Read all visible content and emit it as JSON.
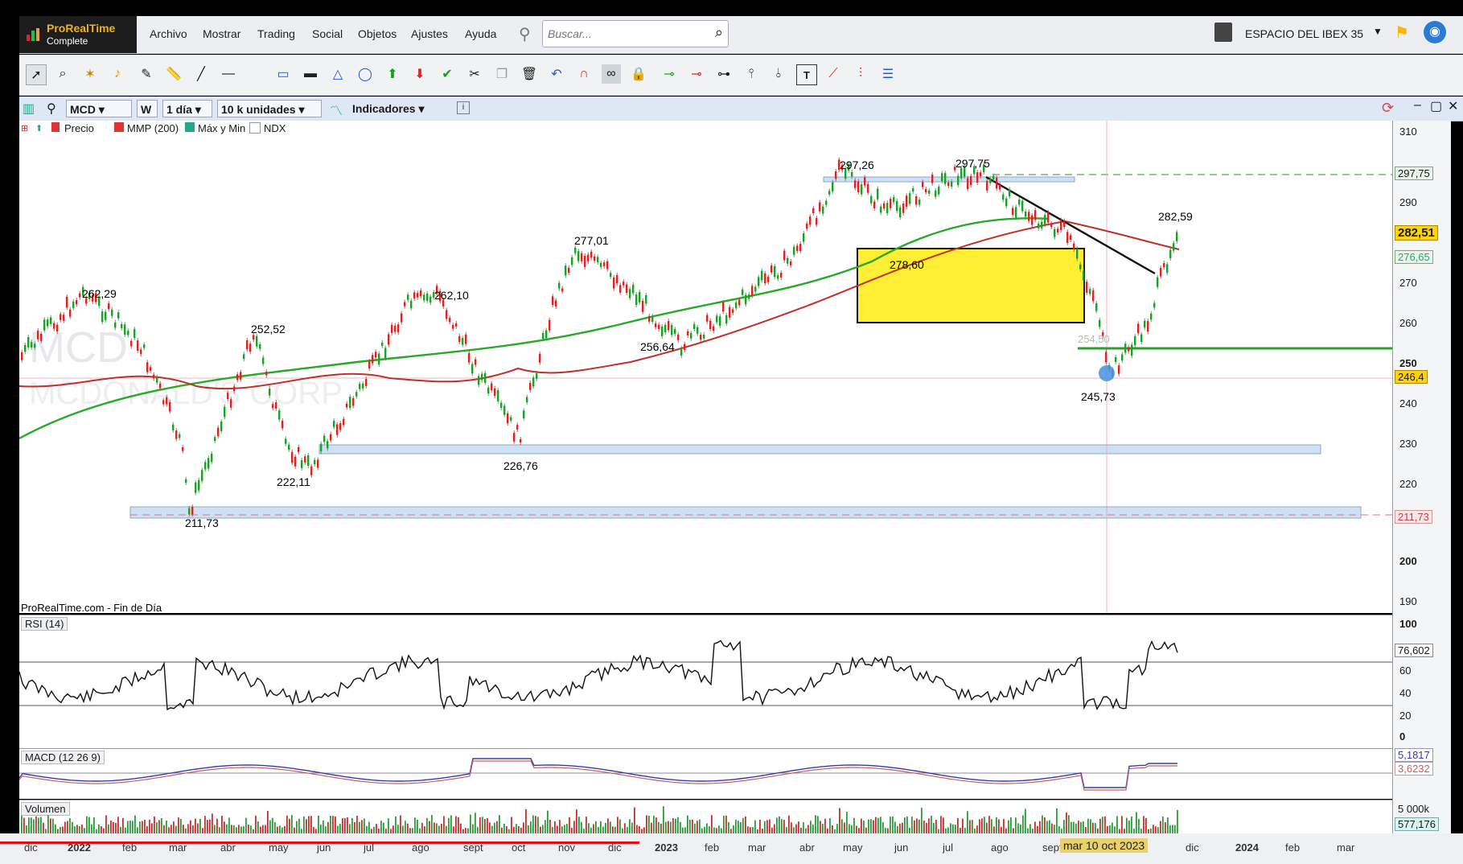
{
  "app": {
    "brand_line1": "ProRealTime",
    "brand_line2": "Complete"
  },
  "menu": [
    "Archivo",
    "Mostrar",
    "Trading",
    "Social",
    "Objetos",
    "Ajustes",
    "Ayuda"
  ],
  "search": {
    "placeholder": "Buscar..."
  },
  "workspace": {
    "label": "ESPACIO DEL IBEX 35"
  },
  "chart_header": {
    "symbol": "MCD",
    "period_code": "W",
    "timeframe": "1 día",
    "units": "10 k unidades",
    "indicators": "Indicadores"
  },
  "legend": {
    "price": "Precio",
    "mmp": "MMP (200)",
    "maxmin": "Máx y Min",
    "ndx": "NDX"
  },
  "watermark": {
    "ticker": "MCD",
    "name": "MCDONALD'S CORP"
  },
  "source_label": "ProRealTime.com - Fin de Día",
  "price_labels": [
    "262,29",
    "252,52",
    "222,11",
    "211,73",
    "262,10",
    "226,76",
    "277,01",
    "256,64",
    "297,26",
    "278,60",
    "297,75",
    "282,59",
    "245,73",
    "254,50"
  ],
  "y_axis": [
    "310",
    "290",
    "270",
    "260",
    "250",
    "240",
    "230",
    "220",
    "200",
    "190"
  ],
  "axis_badges": {
    "top": "297,75",
    "current": "282,51",
    "mmp": "276,65",
    "low": "246,4",
    "bottom": "211,73"
  },
  "rsi": {
    "label": "RSI (14)",
    "value": "76,602",
    "ticks": [
      "100",
      "60",
      "40",
      "20",
      "0"
    ]
  },
  "macd": {
    "label": "MACD (12 26 9)",
    "v1": "5,1817",
    "v2": "3,6232"
  },
  "volume": {
    "label": "Volumen",
    "v1": "5 000k",
    "v2": "577,176"
  },
  "time_axis": {
    "labels": [
      "dic",
      "2022",
      "feb",
      "mar",
      "abr",
      "may",
      "jun",
      "jul",
      "ago",
      "sept",
      "oct",
      "nov",
      "dic",
      "2023",
      "feb",
      "mar",
      "abr",
      "may",
      "jun",
      "jul",
      "ago",
      "sept",
      "dic",
      "2024",
      "feb",
      "mar"
    ],
    "cursor": "mar 10 oct 2023"
  },
  "colors": {
    "mmp_line": "#2aa829",
    "red_ma": "#c0302b",
    "highlight_box": "#ffee33",
    "support_band": "#cfe0f5",
    "support_line": "#2e9c2e"
  }
}
